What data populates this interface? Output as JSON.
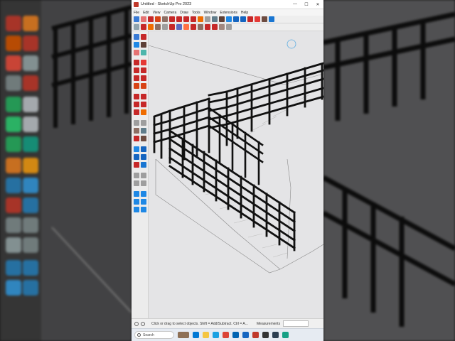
{
  "window": {
    "title": "Untitled - SketchUp Pro 2023",
    "minimize": "—",
    "maximize": "☐",
    "close": "✕"
  },
  "menu": [
    "File",
    "Edit",
    "View",
    "Camera",
    "Draw",
    "Tools",
    "Window",
    "Extensions",
    "Help"
  ],
  "status": {
    "hint": "Click or drag to select objects. Shift = Add/Subtract. Ctrl = A...",
    "measurements_label": "Measurements",
    "measurements_value": ""
  },
  "taskbar": {
    "search_label": "Search"
  },
  "colors": {
    "viewport_bg": "#e4e4e6",
    "railing": "#111111",
    "accent": "#0078d4"
  }
}
